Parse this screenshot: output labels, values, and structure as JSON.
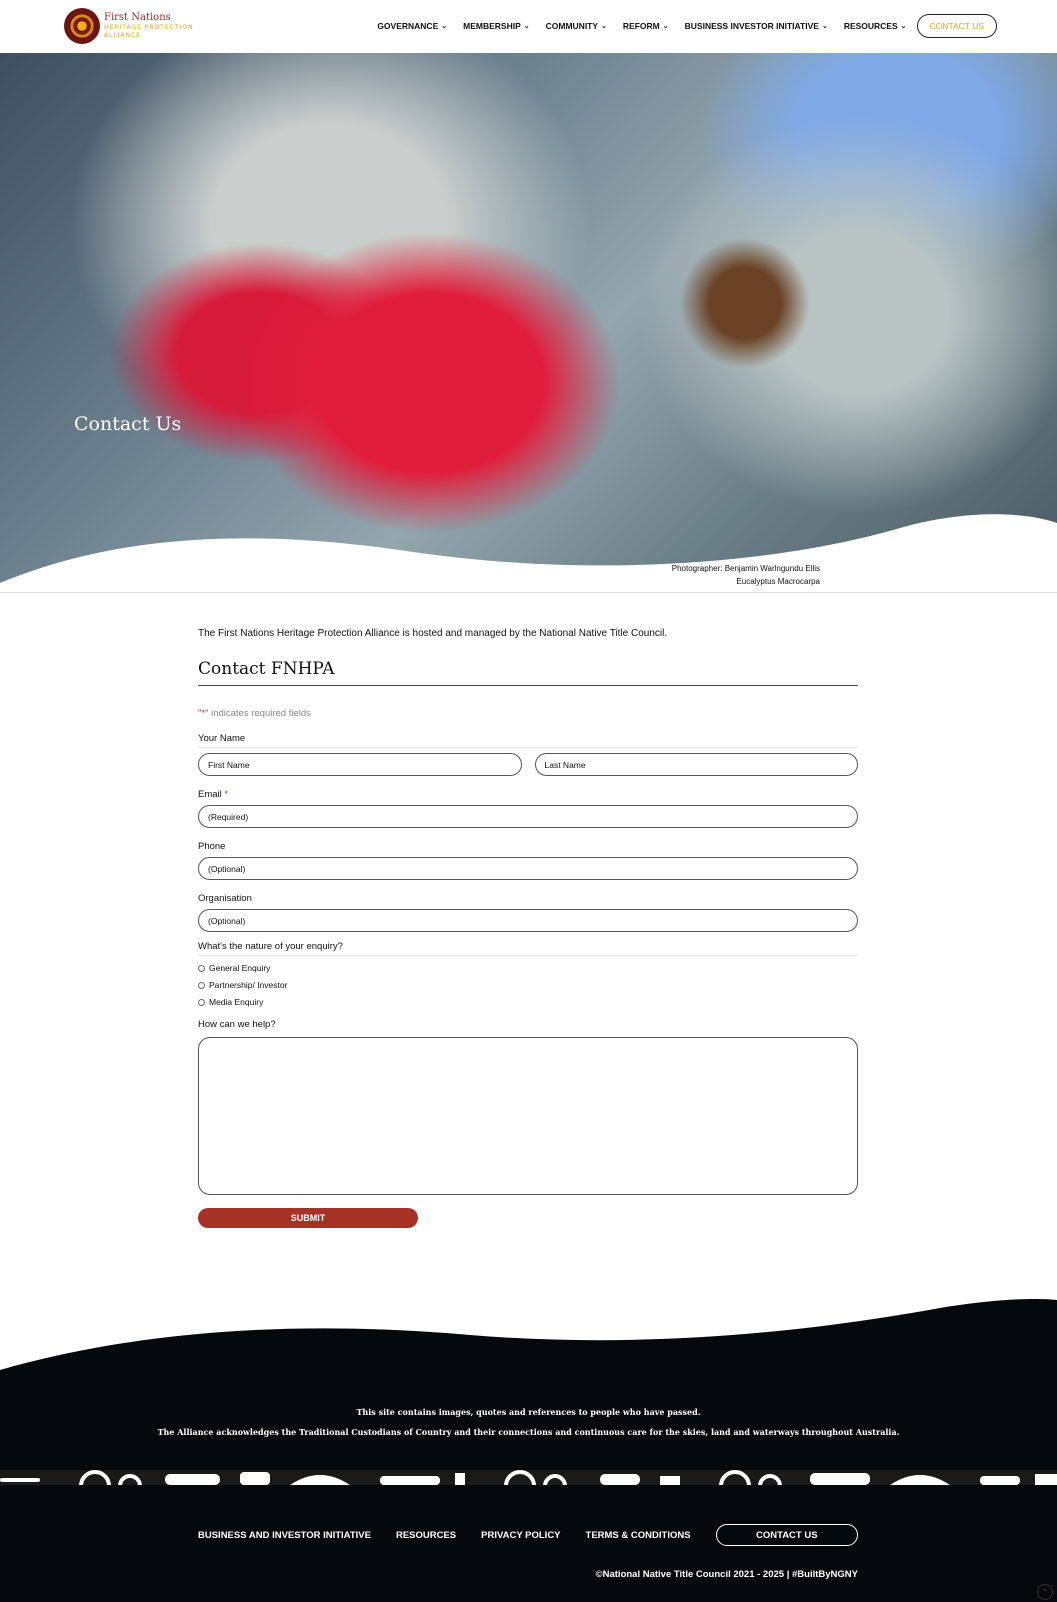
{
  "header": {
    "logo": {
      "line1": "First Nations",
      "line2": "HERITAGE PROTECTION",
      "line3": "ALLIANCE"
    },
    "nav": [
      {
        "label": "GOVERNANCE"
      },
      {
        "label": "MEMBERSHIP"
      },
      {
        "label": "COMMUNITY"
      },
      {
        "label": "REFORM"
      },
      {
        "label": "BUSINESS INVESTOR INITIATIVE"
      },
      {
        "label": "RESOURCES"
      }
    ],
    "cta": "CONTACT US"
  },
  "hero": {
    "title": "Contact Us",
    "caption_line1": "Photographer: Benjamin Warlngundu Ellis",
    "caption_line2": "Eucalyptus Macrocarpa"
  },
  "main": {
    "intro": "The First Nations Heritage Protection Alliance is hosted and managed by the National Native Title Council.",
    "form_title": "Contact FNHPA",
    "required_note_star": "\"*\"",
    "required_note_text": " indicates required fields",
    "fields": {
      "name_label": "Your Name",
      "first_placeholder": "First Name",
      "last_placeholder": "Last Name",
      "email_label": "Email",
      "email_star": "*",
      "email_placeholder": "(Required)",
      "phone_label": "Phone",
      "phone_placeholder": "(Optional)",
      "org_label": "Organisation",
      "org_placeholder": "(Optional)",
      "enquiry_label": "What's the nature of your enquiry?",
      "enquiry_options": [
        "General Enquiry",
        "Partnership/ Investor",
        "Media Enquiry"
      ],
      "help_label": "How can we help?"
    },
    "submit": "SUBMIT"
  },
  "footer": {
    "notice1": "This site contains images, quotes and references to people who have passed.",
    "notice2": "The Alliance acknowledges the Traditional Custodians of Country and their connections and continuous care for the skies, land and waterways throughout Australia.",
    "links": [
      "BUSINESS AND INVESTOR INITIATIVE",
      "RESOURCES",
      "PRIVACY POLICY",
      "TERMS & CONDITIONS"
    ],
    "cta": "CONTACT US",
    "copyright": "©National Native Title Council 2021 - 2025 | #BuiltByNGNY"
  },
  "colors": {
    "accent": "#a63225",
    "gold": "#e6a12a",
    "footer_bg": "#06090b"
  },
  "icons": {
    "nav_dropdown": "chevron-down-icon",
    "back_to_top": "chevron-up-icon"
  }
}
